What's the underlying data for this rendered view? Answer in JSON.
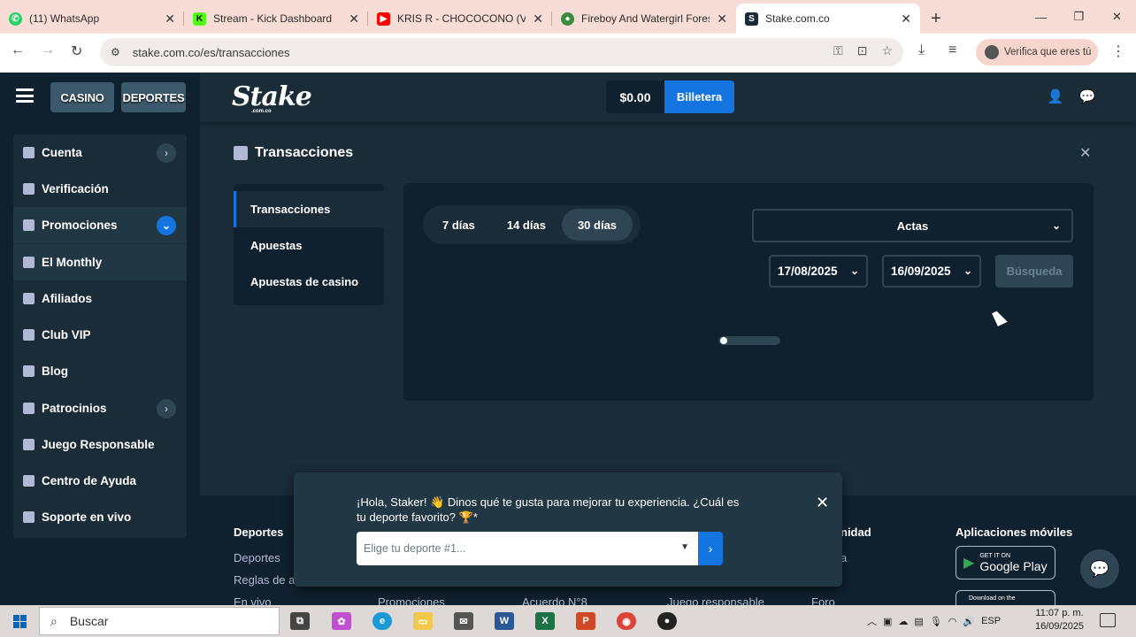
{
  "browser": {
    "tabs": [
      {
        "title": "(11) WhatsApp",
        "icon": "whatsapp-icon",
        "color": "#25d366"
      },
      {
        "title": "Stream - Kick Dashboard",
        "icon": "kick-icon",
        "color": "#53fc18"
      },
      {
        "title": "KRIS R - CHOCOCONO  (Vi",
        "icon": "youtube-icon",
        "color": "#ff0000"
      },
      {
        "title": "Fireboy And Watergirl Fores",
        "icon": "game-icon",
        "color": "#3c8a3c"
      },
      {
        "title": "Stake.com.co",
        "icon": "stake-icon",
        "color": "#1a2c38"
      }
    ],
    "url": "stake.com.co/es/transacciones",
    "verify_label": "Verifica que eres tú"
  },
  "topnav": {
    "casino_label": "CASINO",
    "sports_label": "DEPORTES",
    "logo_text": "Stake",
    "logo_sub": ".com.co",
    "balance": "$0.00",
    "wallet_label": "Billetera"
  },
  "sidebar": {
    "items": [
      {
        "label": "Cuenta",
        "arrow": true
      },
      {
        "label": "Verificación"
      },
      {
        "label": "Promociones",
        "arrow": true
      },
      {
        "label": "El Monthly"
      },
      {
        "label": "Afiliados"
      },
      {
        "label": "Club VIP"
      },
      {
        "label": "Blog"
      },
      {
        "label": "Patrocinios",
        "arrow": true
      },
      {
        "label": "Juego Responsable"
      },
      {
        "label": "Centro de Ayuda"
      },
      {
        "label": "Soporte en vivo"
      }
    ]
  },
  "page": {
    "title": "Transacciones",
    "submenu": [
      "Transacciones",
      "Apuestas",
      "Apuestas de casino"
    ],
    "day_filters": [
      "7 días",
      "14 días",
      "30 días"
    ],
    "active_filter": "30 días",
    "type_select": "Actas",
    "date_from": "17/08/2025",
    "date_to": "16/09/2025",
    "search_label": "Búsqueda"
  },
  "footer": {
    "col1_title": "Deportes",
    "col1_links": [
      "Deportes",
      "Reglas de a",
      "En vivo"
    ],
    "col2_link": "Promociones",
    "col3_link": "Acuerdo N°8",
    "col4_link": "Juego responsable",
    "col5_title": "nidad",
    "col5_links": [
      "a",
      "Foro"
    ],
    "apps_title": "Aplicaciones móviles",
    "gplay_small": "GET IT ON",
    "gplay_big": "Google Play",
    "apple_small": "Download on the"
  },
  "modal": {
    "message": "¡Hola, Staker! 👋 Dinos qué te gusta para mejorar tu experiencia. ¿Cuál es tu deporte favorito? 🏆*",
    "placeholder": "Elige tu deporte #1..."
  },
  "taskbar": {
    "search_label": "Buscar",
    "lang": "ESP",
    "time": "11:07 p. m.",
    "date": "16/09/2025"
  }
}
